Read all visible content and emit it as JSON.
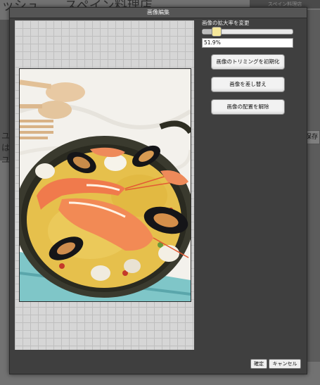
{
  "background": {
    "title_left": "ッシュ",
    "title_main": "スペイン料理店",
    "top_right_label": "スペイン料理店",
    "left_lines": "ユはユ",
    "save_button": "保存"
  },
  "dialog": {
    "title": "画像編集",
    "zoom": {
      "label": "画像の拡大率を変更",
      "value_text": "51.9%",
      "slider_fraction": 0.1
    },
    "buttons": {
      "reset_trim": "画像のトリミングを初期化",
      "replace": "画像を差し替え",
      "remove": "画像の配置を解除"
    },
    "footer": {
      "confirm": "確定",
      "cancel": "キャンセル"
    }
  },
  "colors": {
    "dialog_bg": "#3f3f3f",
    "slider_thumb": "#f5e79a"
  }
}
